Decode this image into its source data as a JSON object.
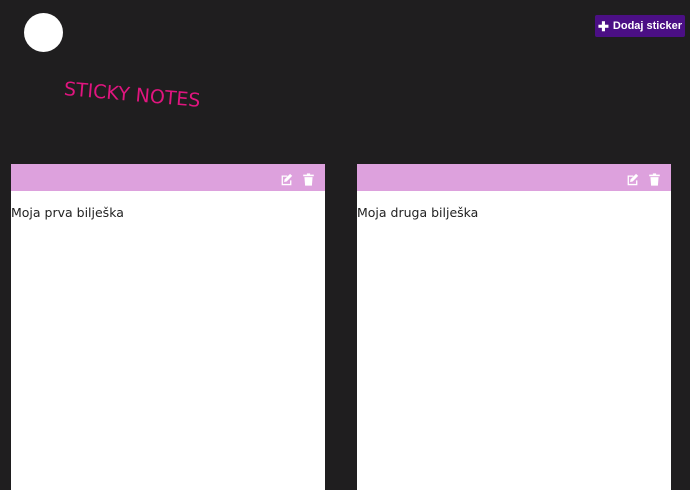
{
  "header": {
    "brand": "STICKY NOTES",
    "add_button_label": "Dodaj sticker",
    "add_icon": "plus-icon"
  },
  "notes": [
    {
      "text": "Moja prva bilješka",
      "edit_icon": "edit-icon",
      "delete_icon": "trash-icon"
    },
    {
      "text": "Moja druga bilješka",
      "edit_icon": "edit-icon",
      "delete_icon": "trash-icon"
    }
  ],
  "colors": {
    "background": "#1f1e1f",
    "brand": "#e0157f",
    "button": "#4b0f85",
    "note_header": "#dda1dd",
    "note_body": "#ffffff"
  }
}
